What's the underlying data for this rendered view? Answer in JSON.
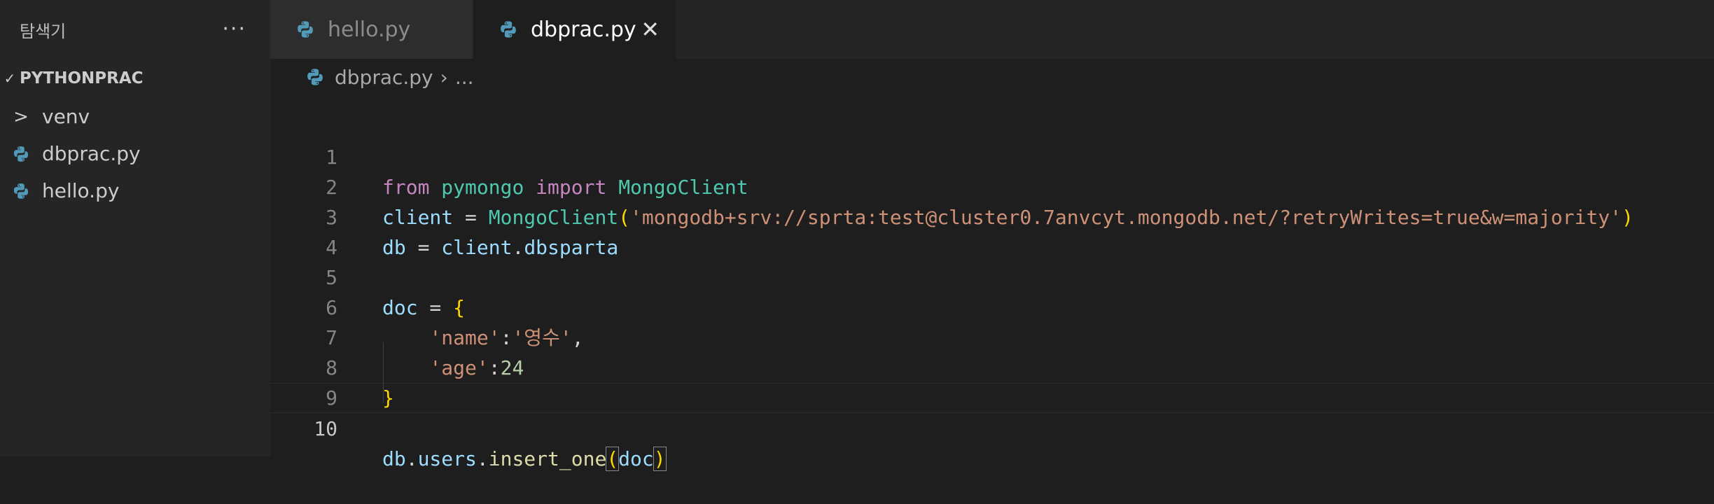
{
  "explorer": {
    "title": "탐색기",
    "more": "···",
    "section": "PYTHONPRAC",
    "items": [
      {
        "label": "venv",
        "type": "folder"
      },
      {
        "label": "dbprac.py",
        "type": "python"
      },
      {
        "label": "hello.py",
        "type": "python"
      }
    ]
  },
  "tabs": [
    {
      "label": "hello.py",
      "active": false
    },
    {
      "label": "dbprac.py",
      "active": true
    }
  ],
  "breadcrumb": {
    "file": "dbprac.py",
    "ellipsis": "..."
  },
  "editor": {
    "current_line": 10,
    "line_numbers": [
      "1",
      "2",
      "3",
      "4",
      "5",
      "6",
      "7",
      "8",
      "9",
      "10"
    ],
    "code": {
      "l1": {
        "from": "from",
        "module": "pymongo",
        "import": "import",
        "cls": "MongoClient"
      },
      "l2": {
        "var": "client",
        "eq": " = ",
        "cls": "MongoClient",
        "open": "(",
        "str": "'mongodb+srv://sprta:test@cluster0.7anvcyt.mongodb.net/?retryWrites=true&w=majority'",
        "close": ")"
      },
      "l3": {
        "var": "db",
        "eq": " = ",
        "obj": "client",
        "dot": ".",
        "attr": "dbsparta"
      },
      "l5": {
        "var": "doc",
        "eq": " = ",
        "brace": "{"
      },
      "l6": {
        "key": "'name'",
        "colon": ":",
        "value": "'영수'",
        "comma": ","
      },
      "l7": {
        "key": "'age'",
        "colon": ":",
        "value": "24"
      },
      "l8": {
        "brace": "}"
      },
      "l10": {
        "obj": "db",
        "dot1": ".",
        "attr": "users",
        "dot2": ".",
        "fn": "insert_one",
        "open": "(",
        "arg": "doc",
        "close": ")"
      }
    }
  },
  "colors": {
    "editor_bg": "#1e1e1e",
    "sidebar_bg": "#252526",
    "keyword": "#c586c0",
    "class": "#4ec9b0",
    "variable": "#9cdcfe",
    "string": "#ce9178",
    "number": "#b5cea8",
    "function": "#dcdcaa",
    "python_icon": "#519aba"
  }
}
